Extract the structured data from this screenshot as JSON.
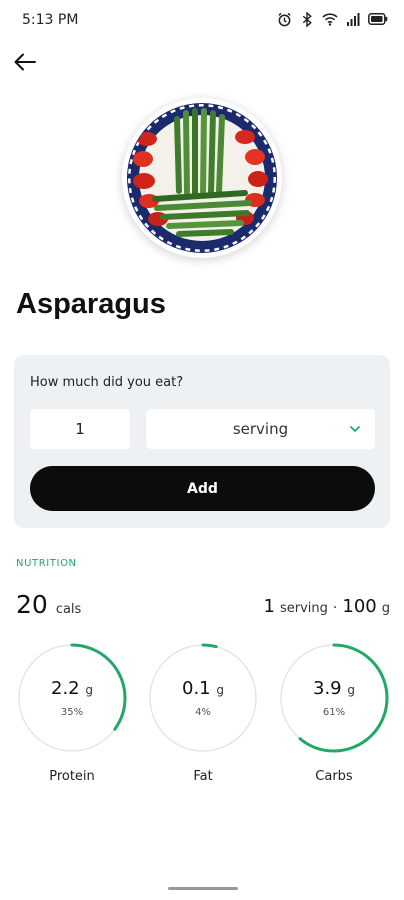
{
  "status_bar": {
    "time": "5:13 PM",
    "icons": [
      "alarm-icon",
      "bluetooth-icon",
      "wifi-icon",
      "signal-icon",
      "battery-icon"
    ]
  },
  "header": {
    "back_icon": "arrow-left-icon"
  },
  "food": {
    "title": "Asparagus",
    "image": "asparagus-plate"
  },
  "amount": {
    "question": "How much did you eat?",
    "quantity_value": "1",
    "unit_selected": "serving",
    "add_label": "Add"
  },
  "nutrition": {
    "section_label": "NUTRITION",
    "calories": "20",
    "calories_unit": "cals",
    "serving_qty": "1",
    "serving_unit": "serving",
    "separator": "·",
    "weight": "100",
    "weight_unit": "g",
    "macros": [
      {
        "name": "Protein",
        "amount": "2.2",
        "unit": "g",
        "percent_label": "35%",
        "fraction": 0.35
      },
      {
        "name": "Fat",
        "amount": "0.1",
        "unit": "g",
        "percent_label": "4%",
        "fraction": 0.04
      },
      {
        "name": "Carbs",
        "amount": "3.9",
        "unit": "g",
        "percent_label": "61%",
        "fraction": 0.61
      }
    ]
  },
  "colors": {
    "accent_green": "#20a866",
    "ring_track": "#e3e6e8",
    "button_dark": "#0c0c0c",
    "card_bg": "#eef1f3"
  }
}
